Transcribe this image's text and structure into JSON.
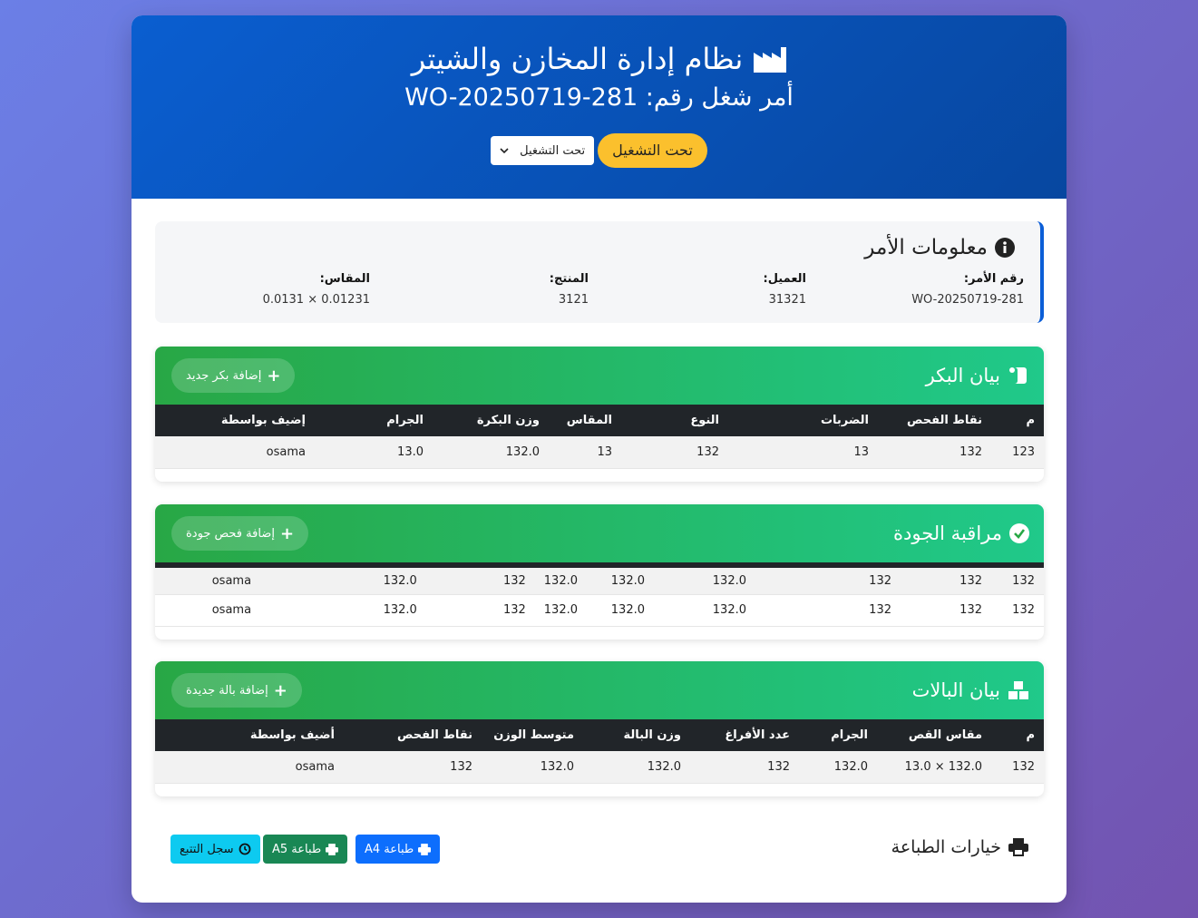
{
  "header": {
    "title": "نظام إدارة المخازن والشيتر",
    "work_order_label": "أمر شغل رقم: WO-20250719-281",
    "status_badge": "تحت التشغيل",
    "status_select": "تحت التشغيل"
  },
  "order_info": {
    "title": "معلومات الأمر",
    "fields": [
      {
        "label": "رقم الأمر:",
        "value": "WO-20250719-281"
      },
      {
        "label": "العميل:",
        "value": "31321"
      },
      {
        "label": "المنتج:",
        "value": "3121"
      },
      {
        "label": "المقاس:",
        "value": "0.01231 × 0.0131"
      }
    ]
  },
  "rolls": {
    "title": "بيان البكر",
    "add_label": "إضافة بكر جديد",
    "columns": [
      "م",
      "نقاط الفحص",
      "الضربات",
      "النوع",
      "المقاس",
      "وزن البكرة",
      "الجرام",
      "إضيف بواسطة"
    ],
    "rows": [
      [
        "123",
        "132",
        "13",
        "132",
        "13",
        "132.0",
        "13.0",
        "osama"
      ]
    ]
  },
  "quality": {
    "title": "مراقبة الجودة",
    "add_label": "إضافة فحص جودة",
    "rows": [
      [
        "132",
        "132",
        "132",
        "132.0",
        "132.0",
        "132.0",
        "132",
        "132.0",
        "osama"
      ],
      [
        "132",
        "132",
        "132",
        "132.0",
        "132.0",
        "132.0",
        "132",
        "132.0",
        "osama"
      ]
    ]
  },
  "pallets": {
    "title": "بيان البالات",
    "add_label": "إضافة بالة جديدة",
    "columns": [
      "م",
      "مقاس القص",
      "الجرام",
      "عدد الأفراغ",
      "وزن البالة",
      "متوسط الوزن",
      "نقاط الفحص",
      "أضيف بواسطة"
    ],
    "rows": [
      [
        "132",
        "132.0 × 13.0",
        "132.0",
        "132",
        "132.0",
        "132.0",
        "132",
        "osama"
      ]
    ]
  },
  "print": {
    "title": "خيارات الطباعة",
    "a4_label": "طباعة A4",
    "a5_label": "طباعة A5",
    "log_label": "سجل التتبع"
  },
  "colors": {
    "header_blue": "#0a5ed0",
    "status_yellow": "#fbc02d",
    "section_green": "#28a745",
    "a4_blue": "#0d6efd",
    "a5_green": "#198754",
    "log_cyan": "#0dcaf0"
  }
}
